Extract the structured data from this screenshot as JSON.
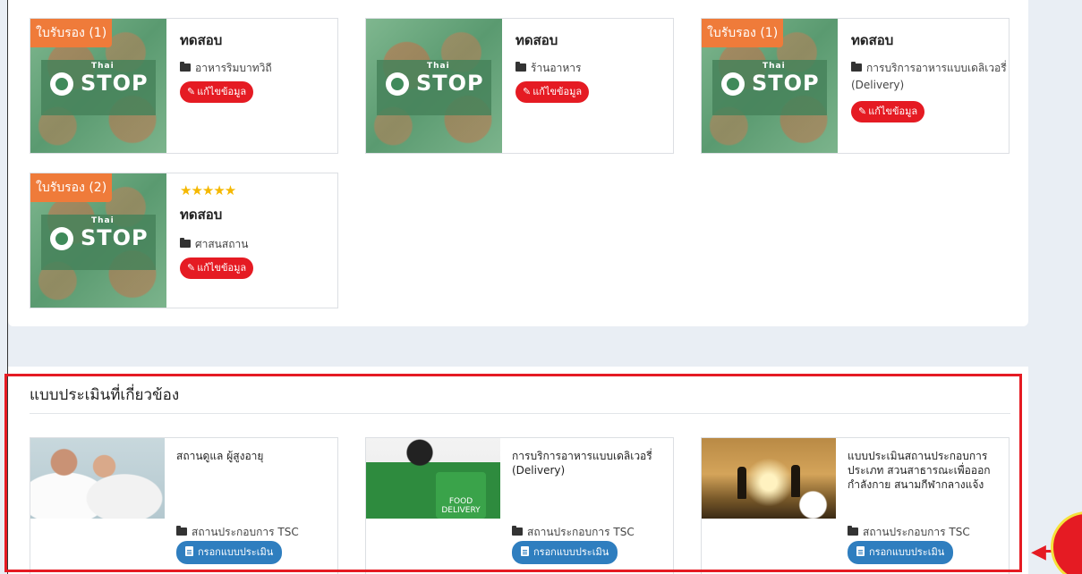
{
  "places": [
    {
      "badge": "ใบรับรอง (1)",
      "title": "ทดสอบ",
      "category": "อาหารริมบาทวิถี",
      "edit_label": "แก้ไขข้อมูล",
      "rating": ""
    },
    {
      "badge": "",
      "title": "ทดสอบ",
      "category": "ร้านอาหาร",
      "edit_label": "แก้ไขข้อมูล",
      "rating": ""
    },
    {
      "badge": "ใบรับรอง (1)",
      "title": "ทดสอบ",
      "category": "การบริการอาหารแบบเดลิเวอรี่ (Delivery)",
      "edit_label": "แก้ไขข้อมูล",
      "rating": ""
    },
    {
      "badge": "ใบรับรอง (2)",
      "title": "ทดสอบ",
      "category": "ศาสนสถาน",
      "edit_label": "แก้ไขข้อมูล",
      "rating": "★★★★★"
    }
  ],
  "thumb_logo": {
    "brand_small": "Thai",
    "brand_big": "STOP",
    "icon": "thai-stop-covid-logo"
  },
  "related": {
    "section_title": "แบบประเมินที่เกี่ยวข้อง",
    "items": [
      {
        "title": "สถานดูแล ผู้สูงอายุ",
        "category": "สถานประกอบการ TSC",
        "button_label": "กรอกแบบประเมิน"
      },
      {
        "title": "การบริการอาหารแบบเดลิเวอรี่ (Delivery)",
        "category": "สถานประกอบการ TSC",
        "button_label": "กรอกแบบประเมิน",
        "image_text": "FOOD DELIVERY"
      },
      {
        "title": "แบบประเมินสถานประกอบการ ประเภท สวนสาธารณะเพื่อออกกำลังกาย สนามกีฬากลางแจ้ง",
        "category": "สถานประกอบการ TSC",
        "button_label": "กรอกแบบประเมิน"
      }
    ]
  },
  "colors": {
    "badge": "#ef7b3a",
    "edit_button": "#e51b23",
    "eval_button": "#2f7ebf",
    "highlight": "#e51b23",
    "star": "#f5b800"
  }
}
